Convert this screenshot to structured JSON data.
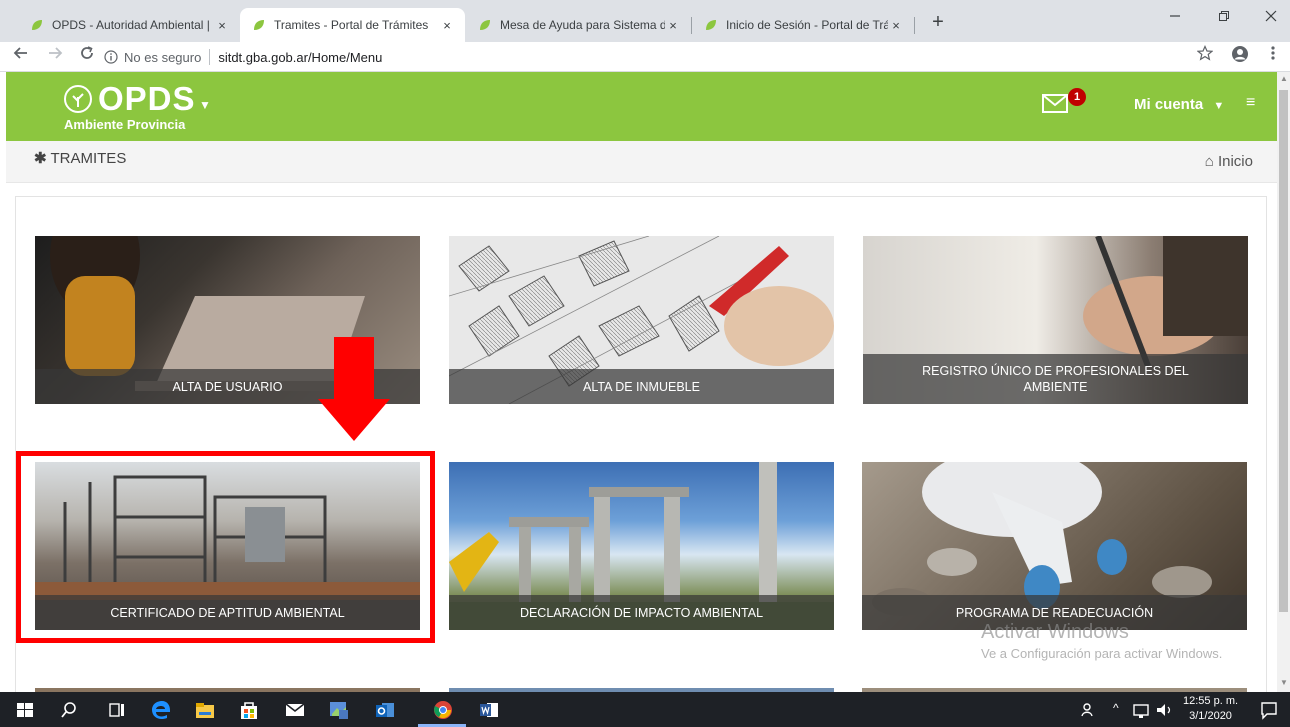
{
  "browser": {
    "tabs": [
      {
        "title": "OPDS - Autoridad Ambiental |",
        "active": false
      },
      {
        "title": "Tramites - Portal de Trámites",
        "active": true
      },
      {
        "title": "Mesa de Ayuda para Sistema de",
        "active": false
      },
      {
        "title": "Inicio de Sesión - Portal de Trámi",
        "active": false
      }
    ],
    "close_glyph": "×",
    "new_tab_glyph": "+",
    "security_label": "No es seguro",
    "url": "sitdt.gba.gob.ar/Home/Menu",
    "icons": {
      "back": "back-arrow-icon",
      "forward": "forward-arrow-icon",
      "reload": "reload-icon",
      "info": "info-icon",
      "star": "bookmark-star-icon",
      "profile": "profile-icon",
      "menu": "kebab-menu-icon"
    }
  },
  "site": {
    "logo_text": "OPDS",
    "logo_subtitle": "Ambiente Provincia",
    "mail_count": "1",
    "account_label": "Mi cuenta",
    "brand_color": "#8cc63f"
  },
  "breadcrumb": {
    "section": "TRAMITES",
    "home": "Inicio"
  },
  "cards": [
    {
      "label": "ALTA DE USUARIO"
    },
    {
      "label": "ALTA DE INMUEBLE"
    },
    {
      "label": "REGISTRO ÚNICO DE PROFESIONALES DEL AMBIENTE"
    },
    {
      "label": "CERTIFICADO DE APTITUD AMBIENTAL"
    },
    {
      "label": "DECLARACIÓN DE IMPACTO AMBIENTAL"
    },
    {
      "label": "PROGRAMA DE READECUACIÓN"
    }
  ],
  "annotation": {
    "highlight_color": "#ff0000"
  },
  "watermark": {
    "line1": "Activar Windows",
    "line2": "Ve a Configuración para activar Windows."
  },
  "taskbar": {
    "time": "12:55 p. m.",
    "date": "3/1/2020"
  }
}
